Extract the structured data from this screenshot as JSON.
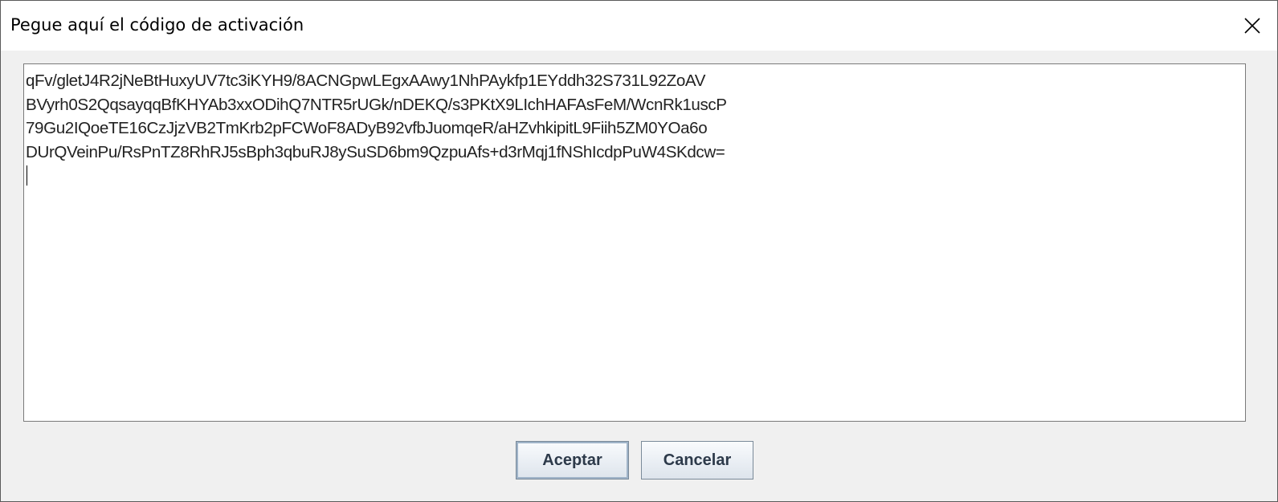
{
  "window": {
    "title": "Pegue aquí el código de activación",
    "close_icon": "close-icon"
  },
  "activation_code": {
    "lines": [
      "qFv/gletJ4R2jNeBtHuxyUV7tc3iKYH9/8ACNGpwLEgxAAwy1NhPAykfp1EYddh32S731L92ZoAV",
      "BVyrh0S2QqsayqqBfKHYAb3xxODihQ7NTR5rUGk/nDEKQ/s3PKtX9LIchHAFAsFeM/WcnRk1uscP",
      "79Gu2IQoeTE16CzJjzVB2TmKrb2pFCWoF8ADyB92vfbJuomqeR/aHZvhkipitL9Fiih5ZM0YOa6o",
      "DUrQVeinPu/RsPnTZ8RhRJ5sBph3qbuRJ8ySuSD6bm9QzpuAfs+d3rMqj1fNShIcdpPuW4SKdcw="
    ]
  },
  "buttons": {
    "accept_label": "Aceptar",
    "cancel_label": "Cancelar"
  }
}
